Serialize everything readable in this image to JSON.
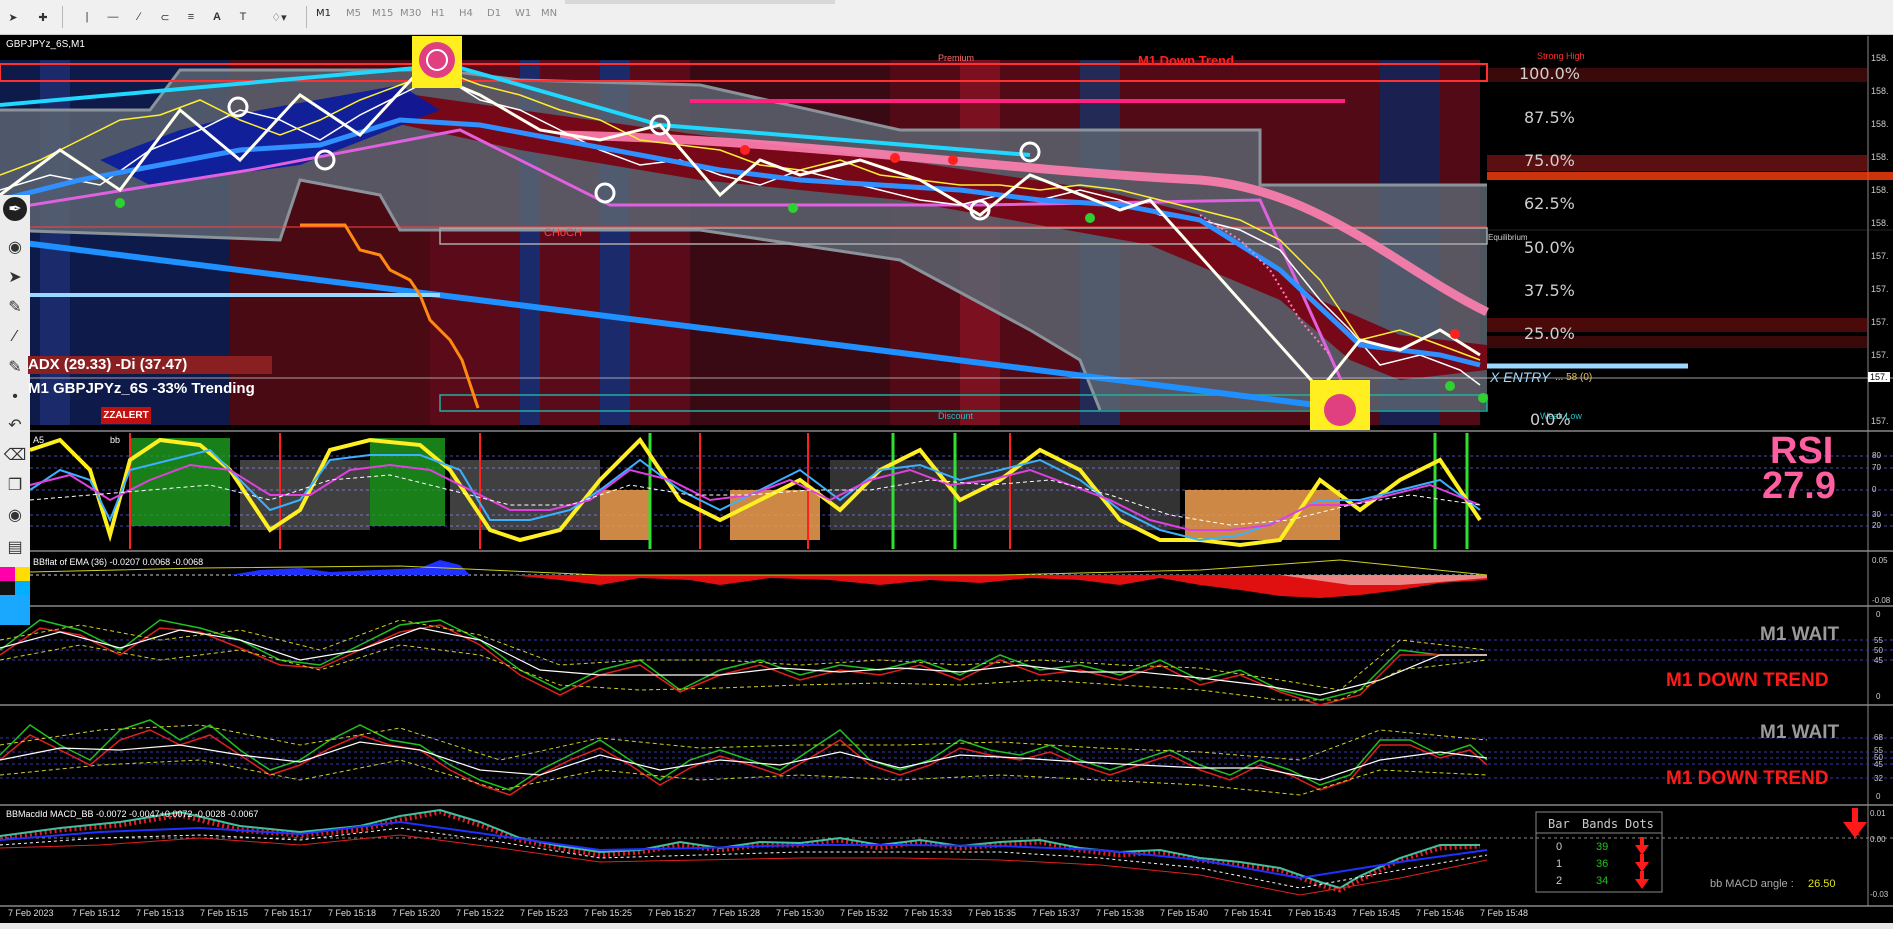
{
  "toolbar": {
    "timeframes": [
      "M1",
      "M5",
      "M15",
      "M30",
      "H1",
      "H4",
      "D1",
      "W1",
      "MN"
    ],
    "active_timeframe": "M1"
  },
  "main_chart": {
    "symbol_label": "GBPJPYz_6S,M1",
    "premium_label": "Premium",
    "trend_label": "M1 Down Trend",
    "strong_high_label": "Strong High",
    "choch_label": "CHoCH",
    "equilibrium_label": "Equilibrium",
    "discount_label": "Discount",
    "weak_low_label": "Weak Low",
    "fib_levels": [
      "100.0%",
      "87.5%",
      "75.0%",
      "62.5%",
      "50.0%",
      "37.5%",
      "25.0%",
      "0.0%"
    ],
    "adx_text": "ADX (29.33)  -Di (37.47)",
    "trend_text": "M1 GBPJPYz_6S -33% Trending",
    "zzalert": "ZZALERT",
    "entry_text": "X ENTRY",
    "entry_value": "... 58 (0)",
    "price_axis": [
      "158.",
      "158.",
      "158.",
      "158.",
      "158.",
      "158.",
      "157.",
      "157.",
      "157.",
      "157.",
      "157.",
      "157."
    ]
  },
  "rsi_panel": {
    "title": "RSI",
    "value": "27.9",
    "prefix": "A5",
    "bb_label": "bb",
    "scale": [
      "80",
      "70",
      "0",
      "30",
      "20"
    ]
  },
  "ema_panel": {
    "label": "BBflat of EMA (36) -0.0207 0.0068 -0.0068",
    "scale": [
      "0.05",
      "-0.08"
    ]
  },
  "panel3": {
    "status": "M1 WAIT",
    "trend": "M1 DOWN TREND",
    "scale": [
      "0",
      "55",
      "50",
      "45",
      "0"
    ]
  },
  "panel4": {
    "status": "M1 WAIT",
    "trend": "M1 DOWN TREND",
    "scale": [
      "68",
      "55",
      "50",
      "45",
      "32",
      "0"
    ]
  },
  "macd_panel": {
    "label": "BBMacdId MACD_BB -0.0072 -0.0047+0.0072 -0.0028 -0.0067",
    "scale": [
      "0.01",
      "0.00",
      "-0.03"
    ],
    "table_headers": [
      "Bar",
      "Bands",
      "Dots"
    ],
    "table_rows": [
      {
        "bar": "0",
        "bands": "39"
      },
      {
        "bar": "1",
        "bands": "36"
      },
      {
        "bar": "2",
        "bands": "34"
      }
    ],
    "angle_label": "bb MACD angle :",
    "angle_value": "26.50"
  },
  "time_axis": [
    "7 Feb 2023",
    "7 Feb 15:12",
    "7 Feb 15:13",
    "7 Feb 15:15",
    "7 Feb 15:17",
    "7 Feb 15:18",
    "7 Feb 15:20",
    "7 Feb 15:22",
    "7 Feb 15:23",
    "7 Feb 15:25",
    "7 Feb 15:27",
    "7 Feb 15:28",
    "7 Feb 15:30",
    "7 Feb 15:32",
    "7 Feb 15:33",
    "7 Feb 15:35",
    "7 Feb 15:37",
    "7 Feb 15:38",
    "7 Feb 15:40",
    "7 Feb 15:41",
    "7 Feb 15:43",
    "7 Feb 15:45",
    "7 Feb 15:46",
    "7 Feb 15:48"
  ],
  "colors": {
    "chart_bg": "#000000",
    "down_red": "#ff2020",
    "rsi_pink": "#ff5fa0",
    "ema_blue": "#1e90ff",
    "panel_gray": "#5a6470"
  }
}
